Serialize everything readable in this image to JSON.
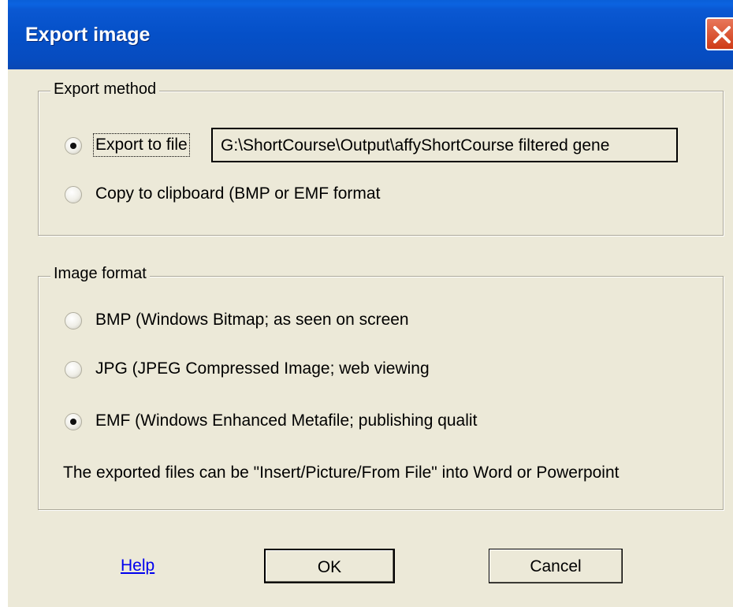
{
  "window": {
    "title": "Export image"
  },
  "export_method": {
    "legend": "Export method",
    "options": [
      {
        "label": "Export to file",
        "selected": true
      },
      {
        "label": "Copy to clipboard (BMP or EMF format",
        "selected": false
      }
    ],
    "file_path": "G:\\ShortCourse\\Output\\affyShortCourse filtered gene"
  },
  "image_format": {
    "legend": "Image format",
    "options": [
      {
        "label": "BMP (Windows Bitmap; as seen on screen",
        "selected": false
      },
      {
        "label": "JPG (JPEG Compressed Image; web viewing",
        "selected": false
      },
      {
        "label": "EMF (Windows Enhanced Metafile; publishing qualit",
        "selected": true
      }
    ],
    "note": "The exported files can be \"Insert/Picture/From File\" into Word or Powerpoint"
  },
  "buttons": {
    "help": "Help",
    "ok": "OK",
    "cancel": "Cancel"
  },
  "icons": {
    "close": "close-icon"
  }
}
